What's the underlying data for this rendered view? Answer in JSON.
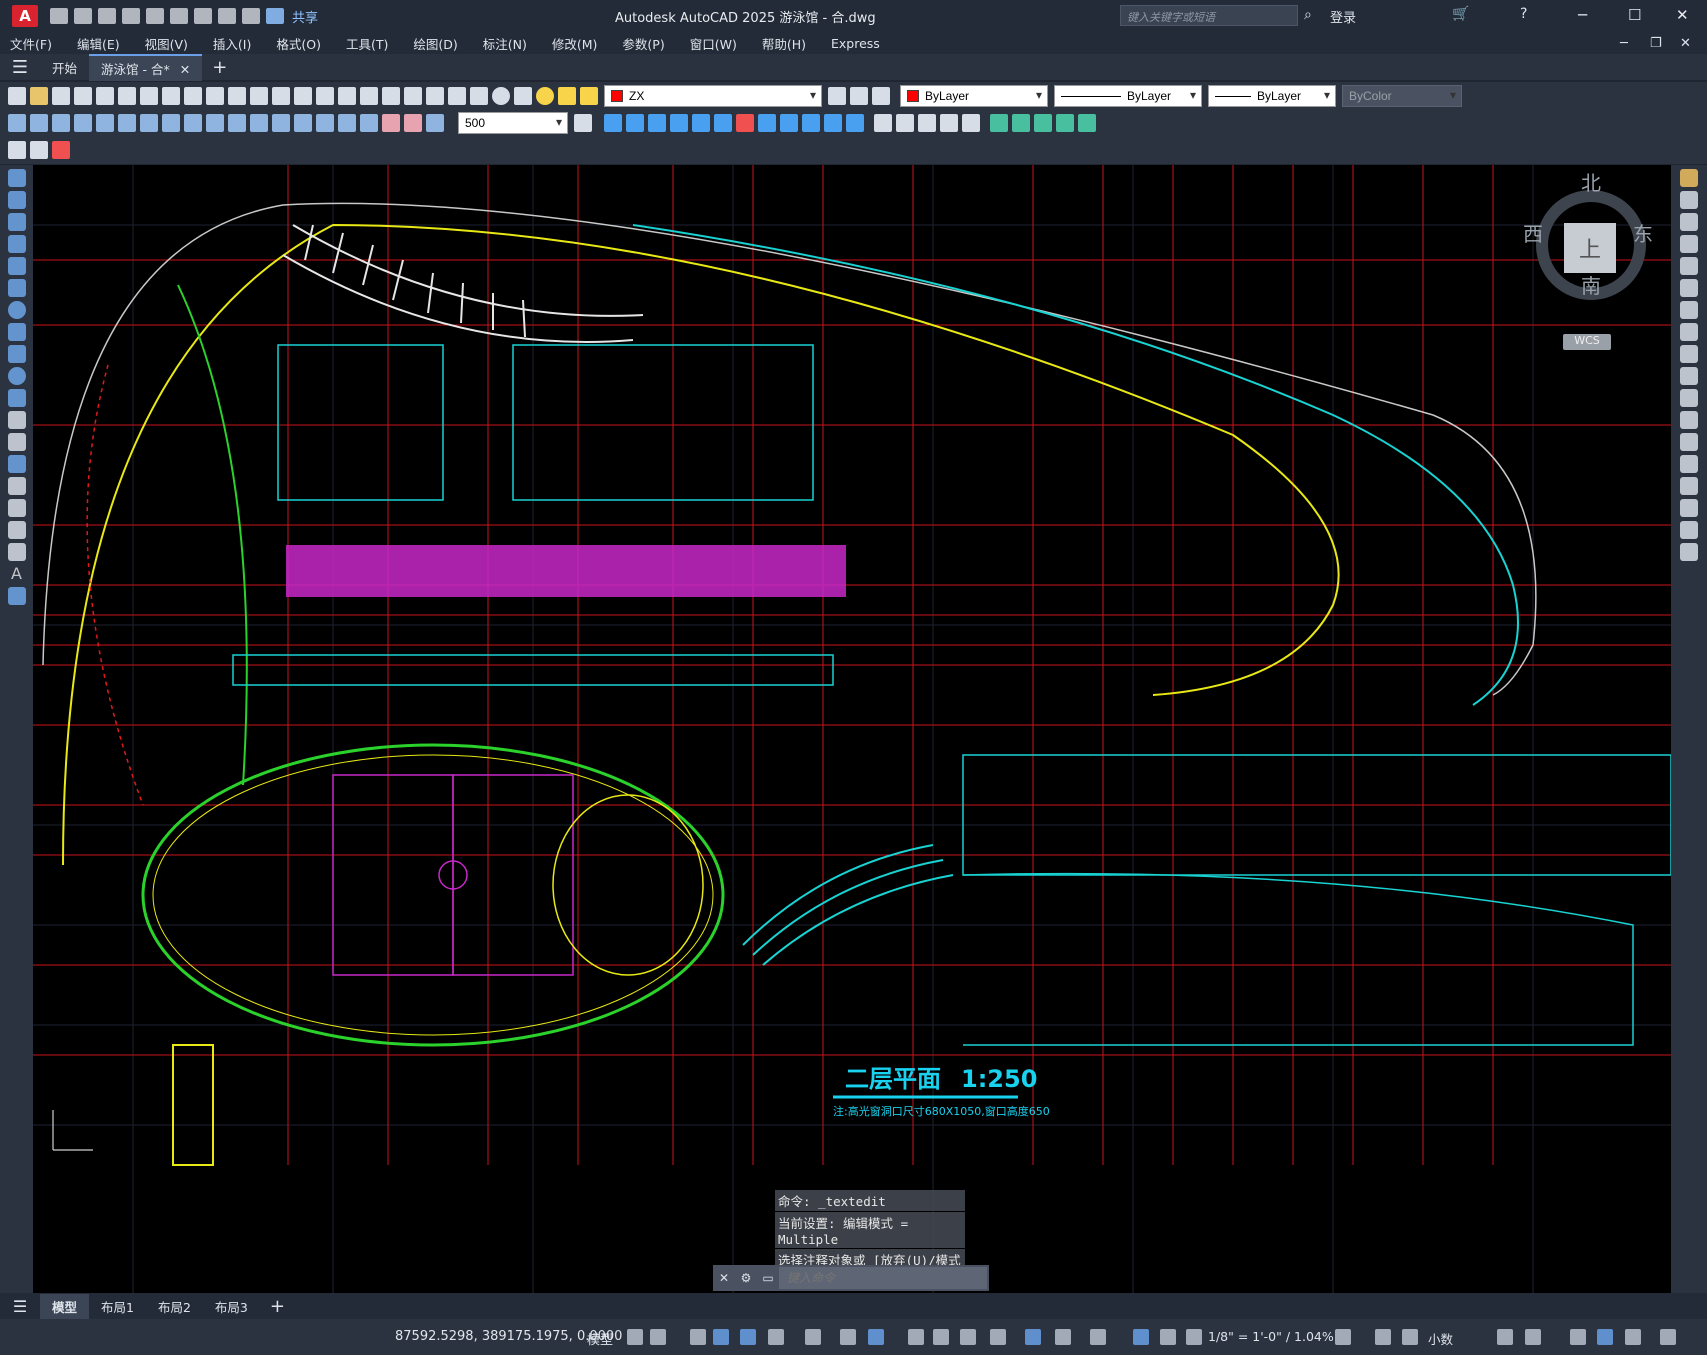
{
  "app": {
    "logo": "A",
    "title": "Autodesk AutoCAD 2025    游泳馆 - 合.dwg",
    "share": "共享",
    "search_placeholder": "键入关键字或短语",
    "login": "登录"
  },
  "menu": [
    "文件(F)",
    "编辑(E)",
    "视图(V)",
    "插入(I)",
    "格式(O)",
    "工具(T)",
    "绘图(D)",
    "标注(N)",
    "修改(M)",
    "参数(P)",
    "窗口(W)",
    "帮助(H)",
    "Express"
  ],
  "tabs": [
    "开始",
    "游泳馆 - 合*"
  ],
  "toolbar": {
    "layer": "ZX",
    "color": "ByLayer",
    "linetype": "ByLayer",
    "lineweight": "ByLayer",
    "plotstyle": "ByColor",
    "dim_scale": "500"
  },
  "viewcube": {
    "north": "北",
    "south": "南",
    "east": "东",
    "west": "西",
    "top": "上",
    "wcs": "WCS"
  },
  "drawing": {
    "plan_title": "二层平面",
    "plan_scale": "1:250",
    "note": "注:高光窗洞口尺寸680X1050,窗口高度650"
  },
  "command": {
    "history": [
      "命令: _textedit",
      "当前设置: 编辑模式 = Multiple",
      "选择注释对象或 [放弃(U)/模式(M)]: *取消*"
    ],
    "placeholder": "键入命令"
  },
  "layout_tabs": [
    "模型",
    "布局1",
    "布局2",
    "布局3"
  ],
  "status": {
    "coords": "87592.5298, 389175.1975, 0.0000",
    "model": "模型",
    "scale": "1/8\" = 1'-0\" / 1.04%",
    "units": "小数"
  },
  "colors": {
    "canvas_bg": "#000000",
    "ui_bg": "#2b3341",
    "accent": "#6aa0e8"
  }
}
